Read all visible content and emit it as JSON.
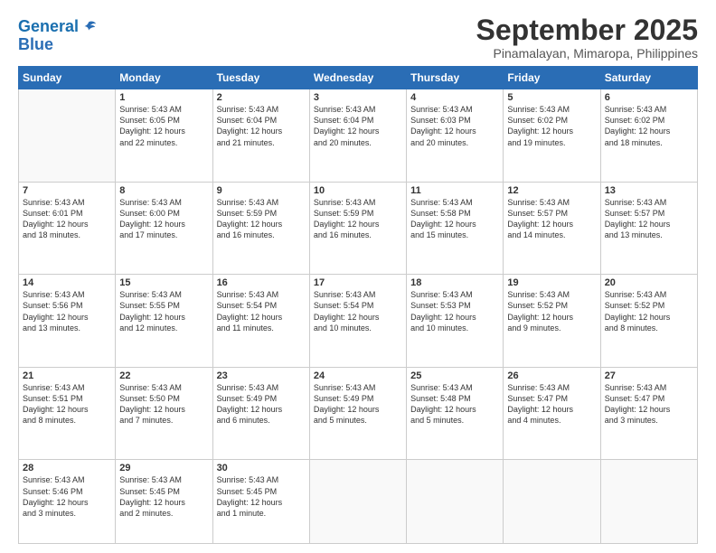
{
  "header": {
    "logo": {
      "line1": "General",
      "line2": "Blue"
    },
    "month": "September 2025",
    "location": "Pinamalayan, Mimaropa, Philippines"
  },
  "weekdays": [
    "Sunday",
    "Monday",
    "Tuesday",
    "Wednesday",
    "Thursday",
    "Friday",
    "Saturday"
  ],
  "weeks": [
    [
      {
        "day": "",
        "info": ""
      },
      {
        "day": "1",
        "info": "Sunrise: 5:43 AM\nSunset: 6:05 PM\nDaylight: 12 hours\nand 22 minutes."
      },
      {
        "day": "2",
        "info": "Sunrise: 5:43 AM\nSunset: 6:04 PM\nDaylight: 12 hours\nand 21 minutes."
      },
      {
        "day": "3",
        "info": "Sunrise: 5:43 AM\nSunset: 6:04 PM\nDaylight: 12 hours\nand 20 minutes."
      },
      {
        "day": "4",
        "info": "Sunrise: 5:43 AM\nSunset: 6:03 PM\nDaylight: 12 hours\nand 20 minutes."
      },
      {
        "day": "5",
        "info": "Sunrise: 5:43 AM\nSunset: 6:02 PM\nDaylight: 12 hours\nand 19 minutes."
      },
      {
        "day": "6",
        "info": "Sunrise: 5:43 AM\nSunset: 6:02 PM\nDaylight: 12 hours\nand 18 minutes."
      }
    ],
    [
      {
        "day": "7",
        "info": "Sunrise: 5:43 AM\nSunset: 6:01 PM\nDaylight: 12 hours\nand 18 minutes."
      },
      {
        "day": "8",
        "info": "Sunrise: 5:43 AM\nSunset: 6:00 PM\nDaylight: 12 hours\nand 17 minutes."
      },
      {
        "day": "9",
        "info": "Sunrise: 5:43 AM\nSunset: 5:59 PM\nDaylight: 12 hours\nand 16 minutes."
      },
      {
        "day": "10",
        "info": "Sunrise: 5:43 AM\nSunset: 5:59 PM\nDaylight: 12 hours\nand 16 minutes."
      },
      {
        "day": "11",
        "info": "Sunrise: 5:43 AM\nSunset: 5:58 PM\nDaylight: 12 hours\nand 15 minutes."
      },
      {
        "day": "12",
        "info": "Sunrise: 5:43 AM\nSunset: 5:57 PM\nDaylight: 12 hours\nand 14 minutes."
      },
      {
        "day": "13",
        "info": "Sunrise: 5:43 AM\nSunset: 5:57 PM\nDaylight: 12 hours\nand 13 minutes."
      }
    ],
    [
      {
        "day": "14",
        "info": "Sunrise: 5:43 AM\nSunset: 5:56 PM\nDaylight: 12 hours\nand 13 minutes."
      },
      {
        "day": "15",
        "info": "Sunrise: 5:43 AM\nSunset: 5:55 PM\nDaylight: 12 hours\nand 12 minutes."
      },
      {
        "day": "16",
        "info": "Sunrise: 5:43 AM\nSunset: 5:54 PM\nDaylight: 12 hours\nand 11 minutes."
      },
      {
        "day": "17",
        "info": "Sunrise: 5:43 AM\nSunset: 5:54 PM\nDaylight: 12 hours\nand 10 minutes."
      },
      {
        "day": "18",
        "info": "Sunrise: 5:43 AM\nSunset: 5:53 PM\nDaylight: 12 hours\nand 10 minutes."
      },
      {
        "day": "19",
        "info": "Sunrise: 5:43 AM\nSunset: 5:52 PM\nDaylight: 12 hours\nand 9 minutes."
      },
      {
        "day": "20",
        "info": "Sunrise: 5:43 AM\nSunset: 5:52 PM\nDaylight: 12 hours\nand 8 minutes."
      }
    ],
    [
      {
        "day": "21",
        "info": "Sunrise: 5:43 AM\nSunset: 5:51 PM\nDaylight: 12 hours\nand 8 minutes."
      },
      {
        "day": "22",
        "info": "Sunrise: 5:43 AM\nSunset: 5:50 PM\nDaylight: 12 hours\nand 7 minutes."
      },
      {
        "day": "23",
        "info": "Sunrise: 5:43 AM\nSunset: 5:49 PM\nDaylight: 12 hours\nand 6 minutes."
      },
      {
        "day": "24",
        "info": "Sunrise: 5:43 AM\nSunset: 5:49 PM\nDaylight: 12 hours\nand 5 minutes."
      },
      {
        "day": "25",
        "info": "Sunrise: 5:43 AM\nSunset: 5:48 PM\nDaylight: 12 hours\nand 5 minutes."
      },
      {
        "day": "26",
        "info": "Sunrise: 5:43 AM\nSunset: 5:47 PM\nDaylight: 12 hours\nand 4 minutes."
      },
      {
        "day": "27",
        "info": "Sunrise: 5:43 AM\nSunset: 5:47 PM\nDaylight: 12 hours\nand 3 minutes."
      }
    ],
    [
      {
        "day": "28",
        "info": "Sunrise: 5:43 AM\nSunset: 5:46 PM\nDaylight: 12 hours\nand 3 minutes."
      },
      {
        "day": "29",
        "info": "Sunrise: 5:43 AM\nSunset: 5:45 PM\nDaylight: 12 hours\nand 2 minutes."
      },
      {
        "day": "30",
        "info": "Sunrise: 5:43 AM\nSunset: 5:45 PM\nDaylight: 12 hours\nand 1 minute."
      },
      {
        "day": "",
        "info": ""
      },
      {
        "day": "",
        "info": ""
      },
      {
        "day": "",
        "info": ""
      },
      {
        "day": "",
        "info": ""
      }
    ]
  ]
}
